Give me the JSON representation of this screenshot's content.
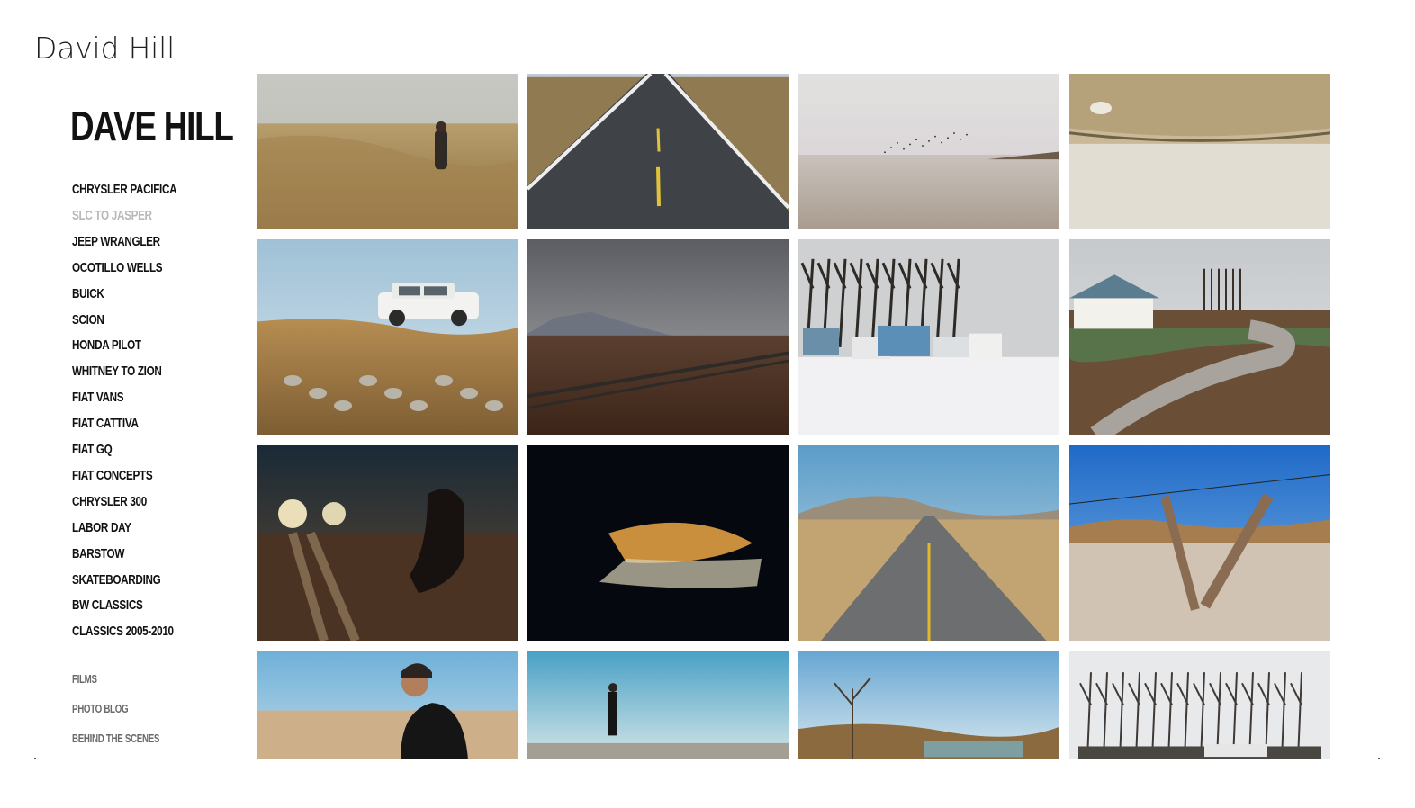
{
  "site": {
    "title": "David Hill",
    "brand": "DAVE HILL"
  },
  "nav": {
    "primary": [
      {
        "label": "CHRYSLER PACIFICA",
        "active": false
      },
      {
        "label": "SLC TO JASPER",
        "active": true
      },
      {
        "label": "JEEP WRANGLER",
        "active": false
      },
      {
        "label": "OCOTILLO WELLS",
        "active": false
      },
      {
        "label": "BUICK",
        "active": false
      },
      {
        "label": "SCION",
        "active": false
      },
      {
        "label": "HONDA PILOT",
        "active": false
      },
      {
        "label": "WHITNEY TO ZION",
        "active": false
      },
      {
        "label": "FIAT VANS",
        "active": false
      },
      {
        "label": "FIAT CATTIVA",
        "active": false
      },
      {
        "label": "FIAT GQ",
        "active": false
      },
      {
        "label": "FIAT CONCEPTS",
        "active": false
      },
      {
        "label": "CHRYSLER 300",
        "active": false
      },
      {
        "label": "LABOR DAY",
        "active": false
      },
      {
        "label": "BARSTOW",
        "active": false
      },
      {
        "label": "SKATEBOARDING",
        "active": false
      },
      {
        "label": "BW CLASSICS",
        "active": false
      },
      {
        "label": "CLASSICS 2005-2010",
        "active": false
      }
    ],
    "secondary": [
      {
        "label": "FILMS"
      },
      {
        "label": "PHOTO BLOG"
      },
      {
        "label": "BEHIND THE SCENES"
      }
    ]
  },
  "gallery": {
    "photos": [
      {
        "subject": "person-walking-in-dry-grass",
        "scene": "grass"
      },
      {
        "subject": "empty-highway",
        "scene": "road"
      },
      {
        "subject": "salt-flats-with-birds",
        "scene": "flats"
      },
      {
        "subject": "sand-shoreline",
        "scene": "sand"
      },
      {
        "subject": "white-suv-on-hill",
        "scene": "suv"
      },
      {
        "subject": "storm-clouds-over-tracks",
        "scene": "storm"
      },
      {
        "subject": "old-trucks-in-snow",
        "scene": "trucks"
      },
      {
        "subject": "winding-dirt-road-house",
        "scene": "winding"
      },
      {
        "subject": "person-crouching-headlights",
        "scene": "night"
      },
      {
        "subject": "lit-grass-at-night",
        "scene": "nightgrass"
      },
      {
        "subject": "straight-desert-highway",
        "scene": "highway"
      },
      {
        "subject": "broken-fence-post",
        "scene": "fence"
      },
      {
        "subject": "man-in-black-jacket",
        "scene": "man"
      },
      {
        "subject": "figure-standing-on-vehicle",
        "scene": "figure"
      },
      {
        "subject": "bare-tree-landscape",
        "scene": "tree"
      },
      {
        "subject": "bare-trees-in-snow",
        "scene": "snowtrees"
      }
    ]
  }
}
